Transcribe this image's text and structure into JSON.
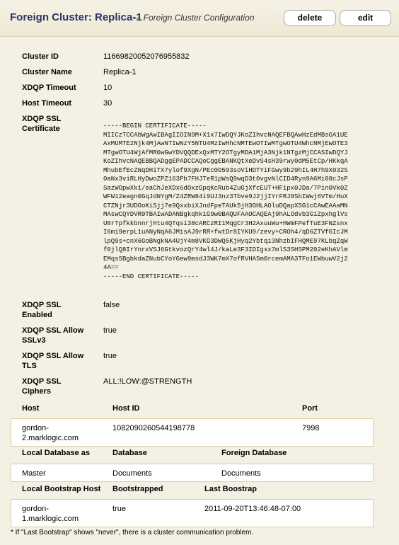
{
  "header": {
    "title": "Foreign Cluster: Replica-1",
    "subtitle_sep": "--",
    "subtitle": "Foreign Cluster Configuration",
    "delete_label": "delete",
    "edit_label": "edit"
  },
  "fields": {
    "cluster_id_label": "Cluster ID",
    "cluster_id": "11669820052076955832",
    "cluster_name_label": "Cluster Name",
    "cluster_name": "Replica-1",
    "xdqp_timeout_label": "XDQP Timeout",
    "xdqp_timeout": "10",
    "host_timeout_label": "Host Timeout",
    "host_timeout": "30",
    "ssl_cert_label_1": "XDQP SSL",
    "ssl_cert_label_2": "Certificate",
    "certificate": "-----BEGIN CERTIFICATE-----\nMIICzTCCAbWgAwIBAgIIOIN9M+X1x7IwDQYJKoZIhvcNAQEFBQAwHzEdMBsGA1UE\nAxMUMTE2Njk4MjAwNTIwNzY5NTU4MzIwHhcNMTEwOTIwMTgwOTU4WhcNMjEwOTE3\nMTgwOTU4WjAfMR0wGwYDVQQDExQxMTY2OTgyMDA1MjA3Njk1NTgzMjCCASIwDQYJ\nKoZIhvcNAQEBBQADggEPADCCAQoCggEBANKQtXeDvS4sH39rwy0dM5EtCp/HKkqA\nMhubEfEcZNqDHiTX7ylof9XgN/PEc0b593soViHDTYiFGwy9b29hIL4H7h9X032S\n0aNx3viRLHyDwoZPZ163Pb7FHJTeR1pWsQ9wqD3t0vgvNlCID4Ryn9A6Mi08cJsP\nSazWOpwXk1/eaChJeXDx6dOxzGpqKcRub4ZuGjXfcEUT+HFipx0JDa/7Pin0Vk0Z\nWFW12eagn0GqJdNYgM/Z4ZRW84i9UJ3nz3Tbve9J2jjIYrFRJ8SbIWwj6VTm/HuX\nCTZNjr3UDOoKiSjj7e9QxxbiXJndFpeTAUk5jH3OHLAOluDQapX5G1cCAwEAAaMN\nMAswCQYDVR0TBAIwADANBgkqhkiG9w0BAQUFAAOCAQEAj9hALOdvb3G1ZpxhglVs\nU8rTpfkkbnnrjHtu4QTqsi38cARCzRI1MqgCr3H2AxuuWu+HWmFPefTuE3FNZsnx\nI6mi9erpL1uANyNqA6JMisAJ9rRR+fwtDr8IYKU9/zevy+CROh4/qD6ZTVfGIcJM\nlpQ9s+cnX6GoBNgkNA4UjY4m8VKG3DWQ5KjHyq2Ybtqi3NhzbIFHQME97KLbqZqW\nf0jlQ8IrYnrxVSJ6GtkvozQrY4wl4J/kaLe3F3IDIgsx7mlS3SHSPM202eKhAVlm\nEMqsSBgbkdaZNubCYoYGew9msdJ3WK7mX7ofRVHA5m0rcemAMA3TFo1EWbuwV2j2\n4A==\n-----END CERTIFICATE-----",
    "ssl_enabled_label_1": "XDQP SSL",
    "ssl_enabled_label_2": "Enabled",
    "ssl_enabled": "false",
    "ssl_v3_label_1": "XDQP SSL Allow",
    "ssl_v3_label_2": "SSLv3",
    "ssl_v3": "true",
    "ssl_tls_label_1": "XDQP SSL Allow",
    "ssl_tls_label_2": "TLS",
    "ssl_tls": "true",
    "ssl_ciphers_label_1": "XDQP SSL",
    "ssl_ciphers_label_2": "Ciphers",
    "ssl_ciphers": "ALL:!LOW:@STRENGTH"
  },
  "hosts_table": {
    "col_host": "Host",
    "col_host_id": "Host ID",
    "col_port": "Port",
    "rows": [
      {
        "host_1": "gordon-",
        "host_2": "2.marklogic.com",
        "host_id": "1082090260544198778",
        "port": "7998"
      }
    ]
  },
  "databases_table": {
    "col_local": "Local Database as",
    "col_database": "Database",
    "col_foreign": "Foreign Database",
    "rows": [
      {
        "local": "Master",
        "database": "Documents",
        "foreign": "Documents"
      }
    ]
  },
  "bootstrap_table": {
    "col_host": "Local Bootstrap Host",
    "col_bootstrapped": "Bootstrapped",
    "col_last": "Last Boostrap",
    "rows": [
      {
        "host_1": "gordon-",
        "host_2": "1.marklogic.com",
        "bootstrapped": "true",
        "last": "2011-09-20T13:46:48-07:00"
      }
    ]
  },
  "footnote": "* If \"Last Bootstrap\" shows \"never\", there is a cluster communication problem."
}
